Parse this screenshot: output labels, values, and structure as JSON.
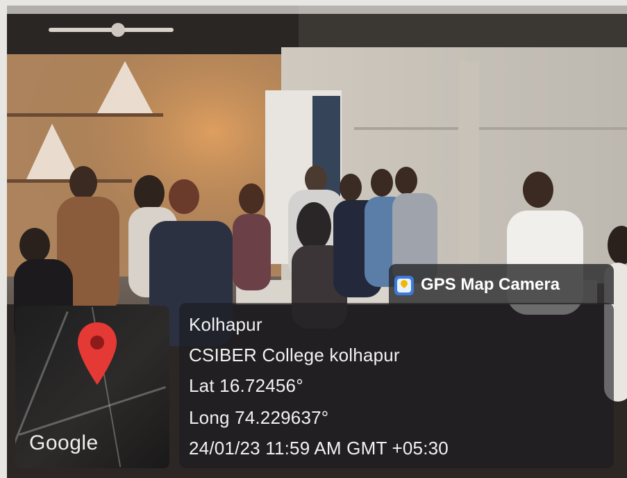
{
  "badge": {
    "label": "GPS Map Camera",
    "icon": "map-pin-app-icon"
  },
  "location": {
    "city": "Kolhapur",
    "address": "CSIBER College kolhapur",
    "latitude": "Lat 16.72456°",
    "longitude": "Long 74.229637°",
    "datetime": "24/01/23 11:59 AM GMT +05:30"
  },
  "map": {
    "attribution": "Google",
    "pin_color": "#e53935"
  },
  "colors": {
    "panel": "#1c1c1e",
    "text": "#f2f2f2",
    "app_icon": "#3d7ad8"
  }
}
